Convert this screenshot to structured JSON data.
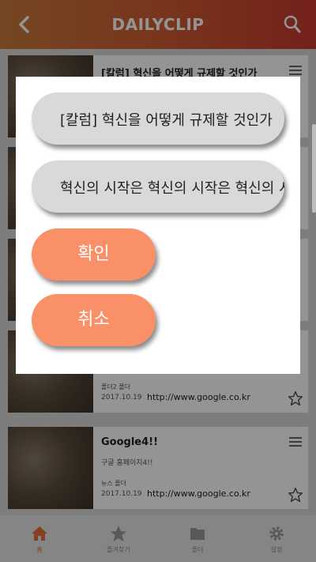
{
  "header": {
    "title": "DAILYCLIP"
  },
  "cards": [
    {
      "title": "[칼럼] 혁신을 어떻게 규제할 것인가",
      "desc": "",
      "folder": "",
      "date": "",
      "url": ""
    },
    {
      "title": "",
      "desc": "",
      "folder": "",
      "date": "",
      "url": ""
    },
    {
      "title": "",
      "desc": "",
      "folder": "",
      "date": "",
      "url": ""
    },
    {
      "title": "",
      "desc": "",
      "folder": "폴더2 폴더",
      "date": "2017.10.19",
      "url": "http://www.google.co.kr"
    },
    {
      "title": "Google4!!",
      "desc": "구글 홈페이지4!!",
      "folder": "뉴스 폴더",
      "date": "2017.10.19",
      "url": "http://www.google.co.kr"
    }
  ],
  "nav": [
    {
      "label": "홈",
      "icon": "home-icon",
      "active": true
    },
    {
      "label": "즐겨찾기",
      "icon": "star-icon",
      "active": false
    },
    {
      "label": "폴더",
      "icon": "folder-icon",
      "active": false
    },
    {
      "label": "설정",
      "icon": "gear-icon",
      "active": false
    }
  ],
  "dialog": {
    "title_value": "[칼럼] 혁신을 어떻게 규제할 것인가",
    "desc_value": "혁신의 시작은 혁신의 시작은 혁신의 시작",
    "confirm_label": "확인",
    "cancel_label": "취소"
  },
  "colors": {
    "accent": "#f99067",
    "header_start": "#c97a3a",
    "header_end": "#c83a2e",
    "nav_active": "#e2703a"
  }
}
